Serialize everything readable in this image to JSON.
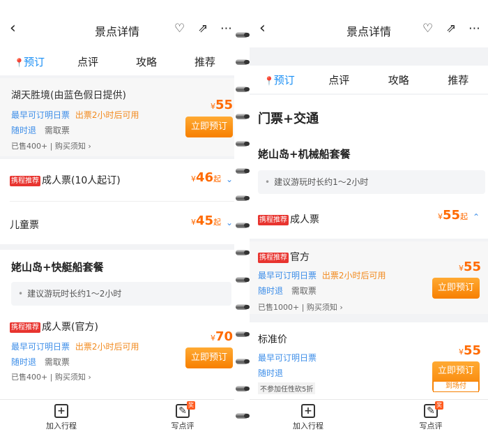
{
  "left": {
    "header": {
      "back_icon": "‹",
      "title": "景点详情"
    },
    "tabs": [
      "预订",
      "点评",
      "攻略",
      "推荐"
    ],
    "supplier": {
      "name": "湖天胜境(由蓝色假日提供)",
      "tag1": "最早可订明日票",
      "tag2": "出票2小时后可用",
      "tag3": "随时退",
      "tag4": "需取票",
      "sold": "已售400+ | 购买须知 ›",
      "price": "55",
      "yen": "¥",
      "button": "立即预订"
    },
    "adult": {
      "tag": "携程推荐",
      "name": "成人票(10人起订)",
      "price": "46",
      "qi": "起"
    },
    "child": {
      "name": "儿童票",
      "price": "45",
      "qi": "起"
    },
    "package": {
      "title": "姥山岛+快艇船套餐",
      "tip": "建议游玩时长约1～2小时",
      "ticket_tag": "携程推荐",
      "ticket_name": "成人票(官方)",
      "tag1": "最早可订明日票",
      "tag2": "出票2小时后可用",
      "tag3": "随时退",
      "tag4": "需取票",
      "sold": "已售400+ | 购买须知 ›",
      "price": "70",
      "button": "立即预订"
    },
    "bottom": {
      "add": "加入行程",
      "review": "写点评",
      "badge": "奖"
    }
  },
  "right": {
    "header": {
      "back_icon": "‹",
      "title": "景点详情"
    },
    "tabs": [
      "预订",
      "点评",
      "攻略",
      "推荐"
    ],
    "section_title": "门票+交通",
    "package": {
      "title": "姥山岛+机械船套餐",
      "tip": "建议游玩时长约1～2小时"
    },
    "adult": {
      "tag": "携程推荐",
      "name": "成人票",
      "price": "55",
      "qi": "起"
    },
    "official": {
      "tag": "携程推荐",
      "name": "官方",
      "tag1": "最早可订明日票",
      "tag2": "出票2小时后可用",
      "tag3": "随时退",
      "tag4": "需取票",
      "sold": "已售1000+ | 购买须知 ›",
      "price": "55",
      "button": "立即预订"
    },
    "standard": {
      "name": "标准价",
      "tag1": "最早可订明日票",
      "tag3": "随时退",
      "note": "不参加任性砍5折",
      "price": "55",
      "button": "立即预订",
      "sub": "到场付"
    },
    "bottom": {
      "add": "加入行程",
      "review": "写点评",
      "badge": "奖"
    }
  },
  "colors": {
    "accent": "#1a8ff5",
    "price": "#ff6a00",
    "button": "#f77f00",
    "tag": "#e8342f"
  }
}
